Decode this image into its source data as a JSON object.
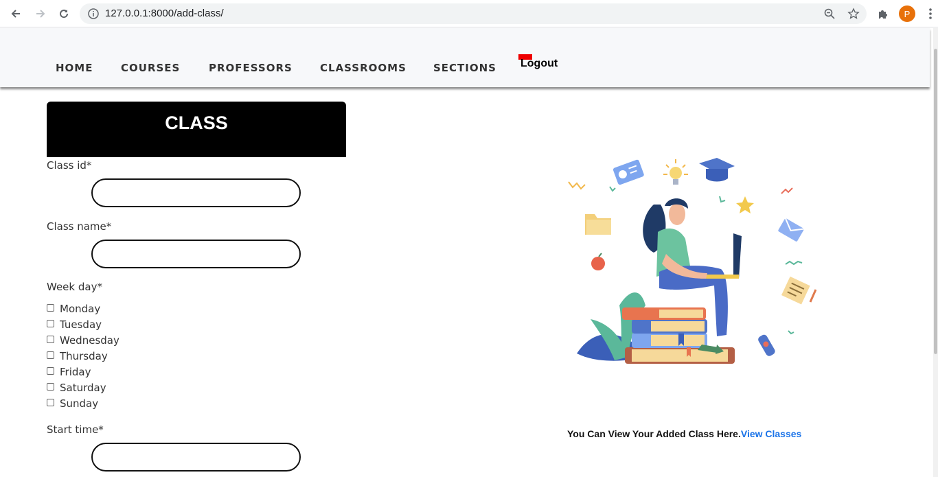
{
  "browser": {
    "url": "127.0.0.1:8000/add-class/",
    "avatar_letter": "P"
  },
  "nav": {
    "items": [
      {
        "label": "HOME"
      },
      {
        "label": "COURSES"
      },
      {
        "label": "PROFESSORS"
      },
      {
        "label": "CLASSROOMS"
      },
      {
        "label": "SECTIONS"
      }
    ],
    "logout_label": "Logout"
  },
  "form": {
    "header": "CLASS",
    "class_id_label": "Class id*",
    "class_id_value": "",
    "class_name_label": "Class name*",
    "class_name_value": "",
    "week_day_label": "Week day*",
    "days": [
      "Monday",
      "Tuesday",
      "Wednesday",
      "Thursday",
      "Friday",
      "Saturday",
      "Sunday"
    ],
    "start_time_label": "Start time*",
    "start_time_value": ""
  },
  "footer": {
    "text": "You Can View Your Added Class Here.",
    "link": "View Classes"
  },
  "colors": {
    "link": "#1a73e8",
    "header_bg": "#000000",
    "avatar": "#e8710a"
  }
}
